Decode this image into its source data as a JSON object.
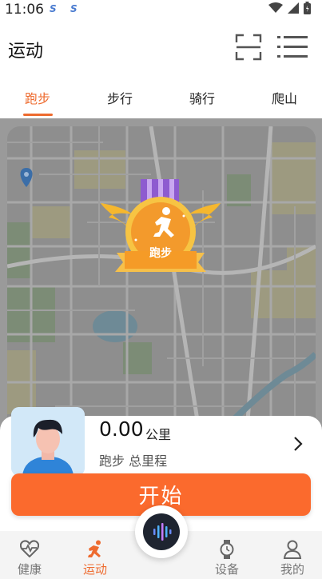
{
  "status_bar": {
    "time": "11:06",
    "app_icons": [
      "S",
      "S"
    ],
    "icons": [
      "wifi-icon",
      "signal-icon",
      "battery-icon"
    ]
  },
  "header": {
    "title": "运动",
    "scan_icon": "scan-icon",
    "menu_icon": "list-menu-icon"
  },
  "tabs": [
    {
      "label": "跑步",
      "active": true
    },
    {
      "label": "步行",
      "active": false
    },
    {
      "label": "骑行",
      "active": false
    },
    {
      "label": "爬山",
      "active": false
    }
  ],
  "medal": {
    "label": "跑步",
    "icon": "running-medal-icon"
  },
  "stats": {
    "distance_value": "0.00",
    "distance_unit": "公里",
    "caption": "跑步 总里程"
  },
  "start_button": {
    "label": "开始"
  },
  "bottom_nav": [
    {
      "label": "健康",
      "icon": "heart-pulse-icon",
      "active": false
    },
    {
      "label": "运动",
      "icon": "runner-icon",
      "active": true
    },
    {
      "label": "设备",
      "icon": "watch-icon",
      "active": false
    },
    {
      "label": "我的",
      "icon": "person-icon",
      "active": false
    }
  ],
  "colors": {
    "accent": "#ee6b2f",
    "start_button": "#fb6a2d",
    "map_overlay": "#9a9a9a"
  }
}
